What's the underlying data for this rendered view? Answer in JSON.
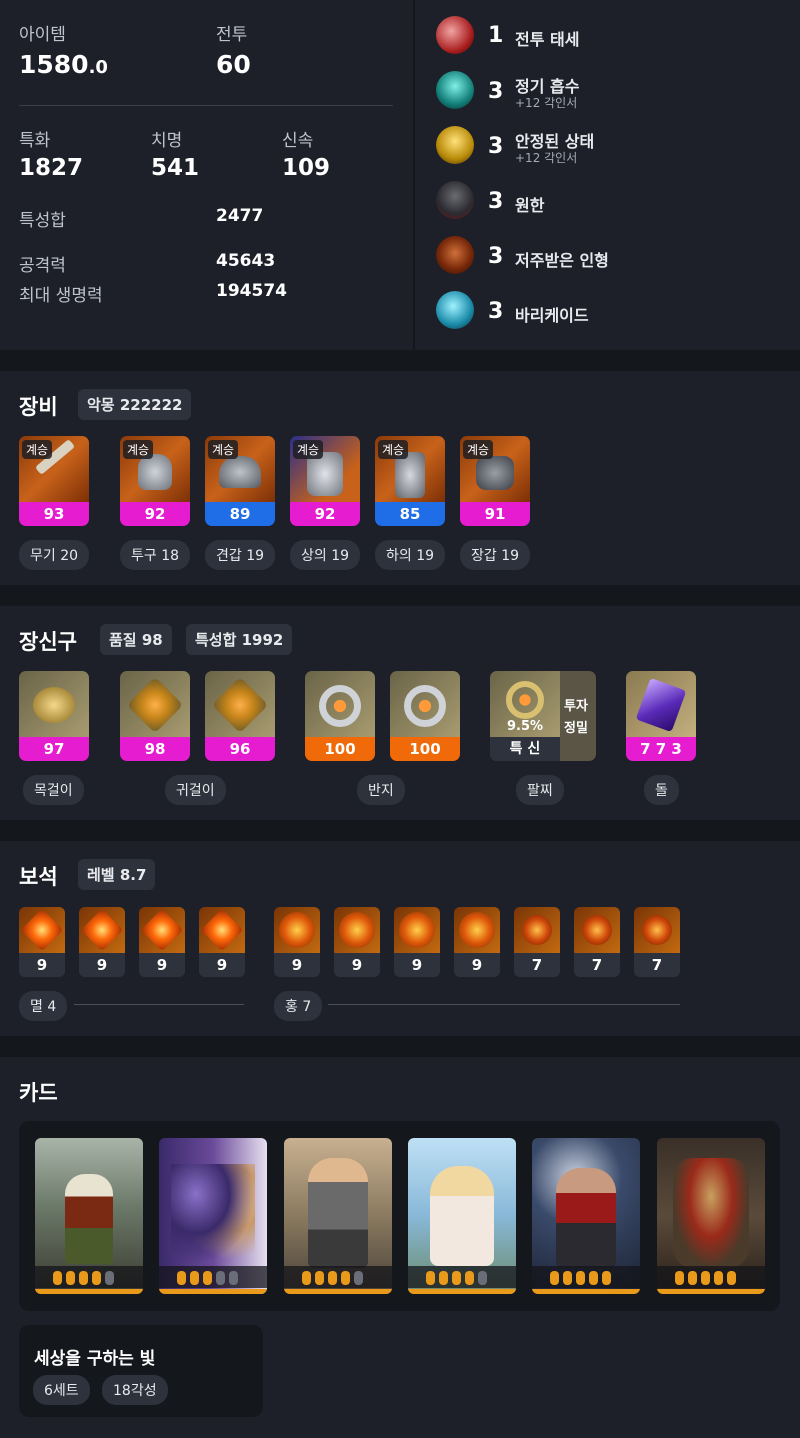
{
  "stats": {
    "item_label": "아이템",
    "item_value": "1580",
    "item_decimal": ".0",
    "combat_label": "전투",
    "combat_value": "60",
    "spec_label": "특화",
    "spec_value": "1827",
    "crit_label": "치명",
    "crit_value": "541",
    "swift_label": "신속",
    "swift_value": "109",
    "total_label": "특성합",
    "total_value": "2477",
    "atk_label": "공격력",
    "atk_value": "45643",
    "hp_label": "최대 생명력",
    "hp_value": "194574"
  },
  "engravings": [
    {
      "level": "1",
      "name": "전투 태세",
      "sub": ""
    },
    {
      "level": "3",
      "name": "정기 흡수",
      "sub": "+12 각인서"
    },
    {
      "level": "3",
      "name": "안정된 상태",
      "sub": "+12 각인서"
    },
    {
      "level": "3",
      "name": "원한",
      "sub": ""
    },
    {
      "level": "3",
      "name": "저주받은 인형",
      "sub": ""
    },
    {
      "level": "3",
      "name": "바리케이드",
      "sub": ""
    }
  ],
  "equipment": {
    "title": "장비",
    "set_badge": "악몽 222222",
    "items": [
      {
        "tag": "계승",
        "quality": "93",
        "label": "무기 20",
        "color": "#e51ccf"
      },
      {
        "tag": "계승",
        "quality": "92",
        "label": "투구 18",
        "color": "#e51ccf"
      },
      {
        "tag": "계승",
        "quality": "89",
        "label": "견갑 19",
        "color": "#1f6ee8"
      },
      {
        "tag": "계승",
        "quality": "92",
        "label": "상의 19",
        "color": "#e51ccf"
      },
      {
        "tag": "계승",
        "quality": "85",
        "label": "하의 19",
        "color": "#1f6ee8"
      },
      {
        "tag": "계승",
        "quality": "91",
        "label": "장갑 19",
        "color": "#e51ccf"
      }
    ]
  },
  "accessories": {
    "title": "장신구",
    "quality_badge": "품질 98",
    "stat_badge": "특성합 1992",
    "items": [
      {
        "quality": "97",
        "color": "#e51ccf"
      },
      {
        "quality": "98",
        "color": "#e51ccf"
      },
      {
        "quality": "96",
        "color": "#e51ccf"
      },
      {
        "quality": "100",
        "color": "#f06a0a"
      },
      {
        "quality": "100",
        "color": "#f06a0a"
      }
    ],
    "bracelet": {
      "percent": "9.5%",
      "stats": "특 신",
      "side_1": "투자",
      "side_2": "정밀"
    },
    "stone": {
      "value": "7 7 3",
      "color": "#e51ccf"
    },
    "labels": [
      "목걸이",
      "귀걸이",
      "반지",
      "팔찌",
      "돌"
    ]
  },
  "gems": {
    "title": "보석",
    "level_badge": "레벨 8.7",
    "left": [
      "9",
      "9",
      "9",
      "9"
    ],
    "right": [
      "9",
      "9",
      "9",
      "9",
      "7",
      "7",
      "7"
    ],
    "left_label": "멸 4",
    "right_label": "홍 7"
  },
  "cards": {
    "title": "카드",
    "awakening": [
      4,
      3,
      4,
      4,
      5,
      5
    ],
    "set_name": "세상을 구하는 빛",
    "set_count": "6세트",
    "awaken_total": "18각성"
  },
  "colors": {
    "legendary": "#e51ccf",
    "epic": "#1f6ee8",
    "relic": "#f06a0a",
    "accent": "#e99a1a"
  }
}
